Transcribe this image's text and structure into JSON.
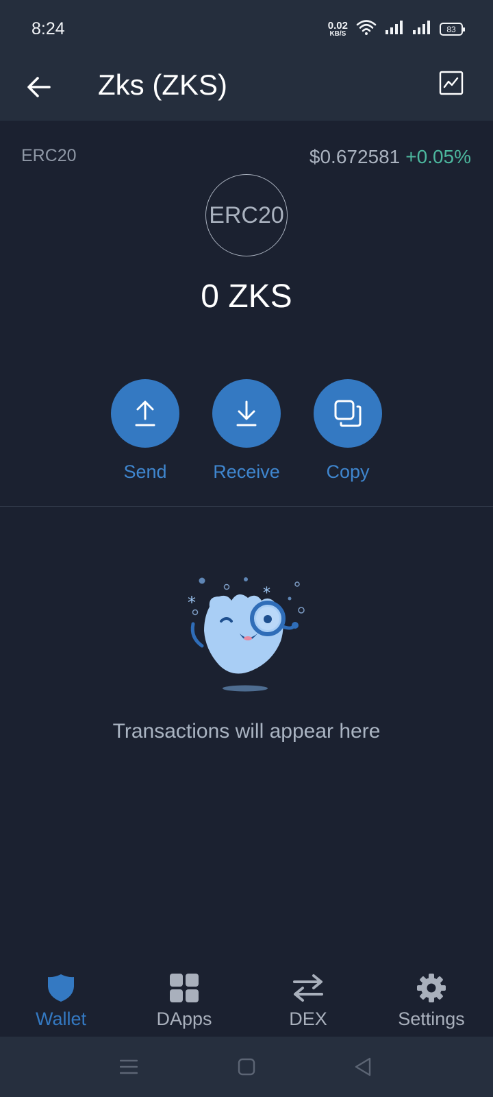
{
  "status_bar": {
    "time": "8:24",
    "net_speed_value": "0.02",
    "net_speed_unit": "KB/S",
    "battery": "83"
  },
  "header": {
    "title": "Zks (ZKS)"
  },
  "token": {
    "network": "ERC20",
    "price": "$0.672581",
    "change": "+0.05%",
    "logo_text": "ERC20",
    "balance": "0 ZKS"
  },
  "actions": [
    {
      "label": "Send",
      "icon": "upload-arrow-icon"
    },
    {
      "label": "Receive",
      "icon": "download-arrow-icon"
    },
    {
      "label": "Copy",
      "icon": "copy-icon"
    }
  ],
  "empty_state": {
    "message": "Transactions will appear here"
  },
  "bottom_nav": [
    {
      "label": "Wallet",
      "icon": "shield-icon",
      "active": true
    },
    {
      "label": "DApps",
      "icon": "grid-icon",
      "active": false
    },
    {
      "label": "DEX",
      "icon": "swap-arrows-icon",
      "active": false
    },
    {
      "label": "Settings",
      "icon": "gear-icon",
      "active": false
    }
  ],
  "colors": {
    "background": "#1b2130",
    "header": "#252e3d",
    "accent": "#3479c2",
    "positive": "#4cb79e"
  }
}
